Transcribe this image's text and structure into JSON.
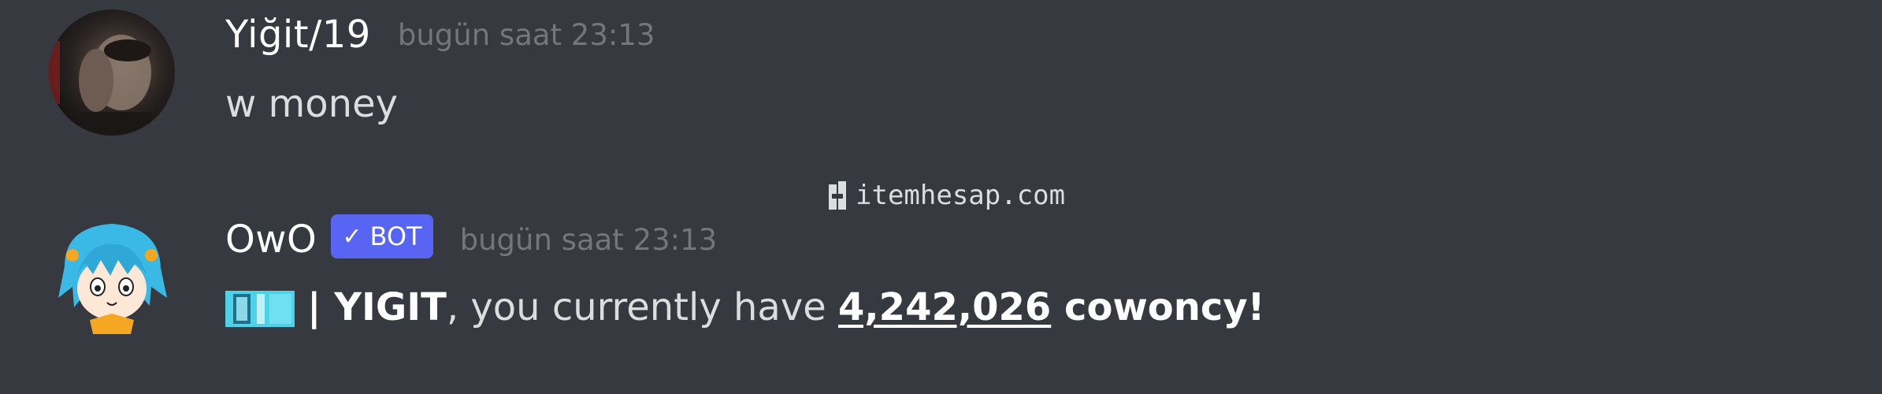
{
  "messages": [
    {
      "username": "Yiğit/19",
      "timestamp": "bugün saat 23:13",
      "content": "w money"
    },
    {
      "username": "OwO",
      "bot_tag": {
        "check": "✓",
        "label": "BOT"
      },
      "timestamp": "bugün saat 23:13",
      "content": {
        "separator": "| ",
        "user": "YIGIT",
        "middle": ", you currently have ",
        "amount": "4,242,026",
        "currency": " cowoncy!"
      }
    }
  ],
  "watermark": {
    "text": "itemhesap.com"
  },
  "icons": {
    "user_avatar": "user-avatar-photo",
    "bot_avatar": "owo-avatar",
    "emoji": "cowoncy-emoji",
    "watermark_logo": "itemhesap-logo"
  },
  "colors": {
    "background": "#36393f",
    "username": "#ffffff",
    "timestamp": "#72767d",
    "text": "#dcddde",
    "bot_tag": "#5865f2"
  }
}
